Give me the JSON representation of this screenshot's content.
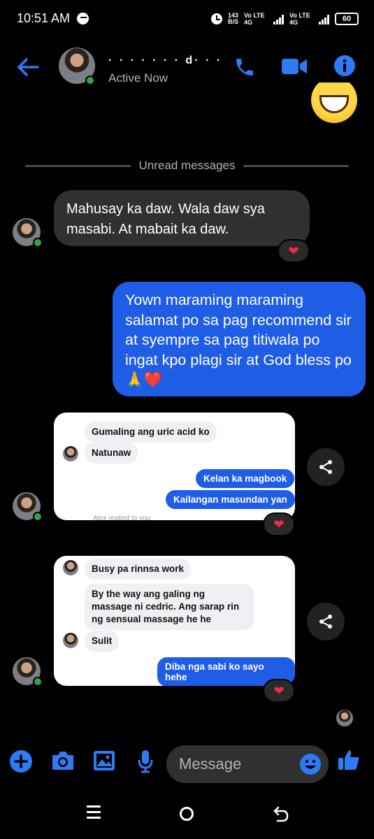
{
  "status_bar": {
    "time": "10:51 AM",
    "net_speed_value": "143",
    "net_speed_unit": "B/S",
    "sim1": "Vo LTE 4G",
    "sim2": "Vo LTE 4G",
    "battery": "60"
  },
  "header": {
    "contact_name": "· · · · ·  · · d· · ·",
    "status": "Active Now"
  },
  "divider": {
    "label": "Unread messages"
  },
  "messages": {
    "incoming_1": "Mahusay ka daw. Wala daw sya masabi. At mabait ka daw.",
    "outgoing_1": "Yown maraming maraming salamat po sa pag recommend sir at syempre sa pag titiwala po ingat kpo plagi sir at God bless po 🙏❤️",
    "reaction": "❤"
  },
  "screenshot_1": {
    "in_1": "Gumaling ang uric acid ko",
    "in_2": "Natunaw",
    "out_1": "Kelan ka magbook",
    "out_2": "Kailangan masundan yan",
    "footer_faint": "Alex replied to you"
  },
  "screenshot_2": {
    "in_1": "Busy pa rinnsa work",
    "in_2": "By the way ang galing ng massage ni cedric. Ang  sarap rin ng sensual massage he he",
    "in_3": "Sulit",
    "out_1": "Diba nga sabi ko sayo hehe"
  },
  "composer": {
    "placeholder": "Message"
  },
  "colors": {
    "accent": "#1f5de6",
    "icon_blue": "#2d7bf5",
    "incoming_bubble": "#303030",
    "heart": "#f02849",
    "online": "#31a24c"
  },
  "icons": [
    "back-arrow",
    "phone",
    "video-camera",
    "info",
    "share",
    "plus",
    "camera",
    "image",
    "microphone",
    "emoji",
    "thumbs-up"
  ]
}
